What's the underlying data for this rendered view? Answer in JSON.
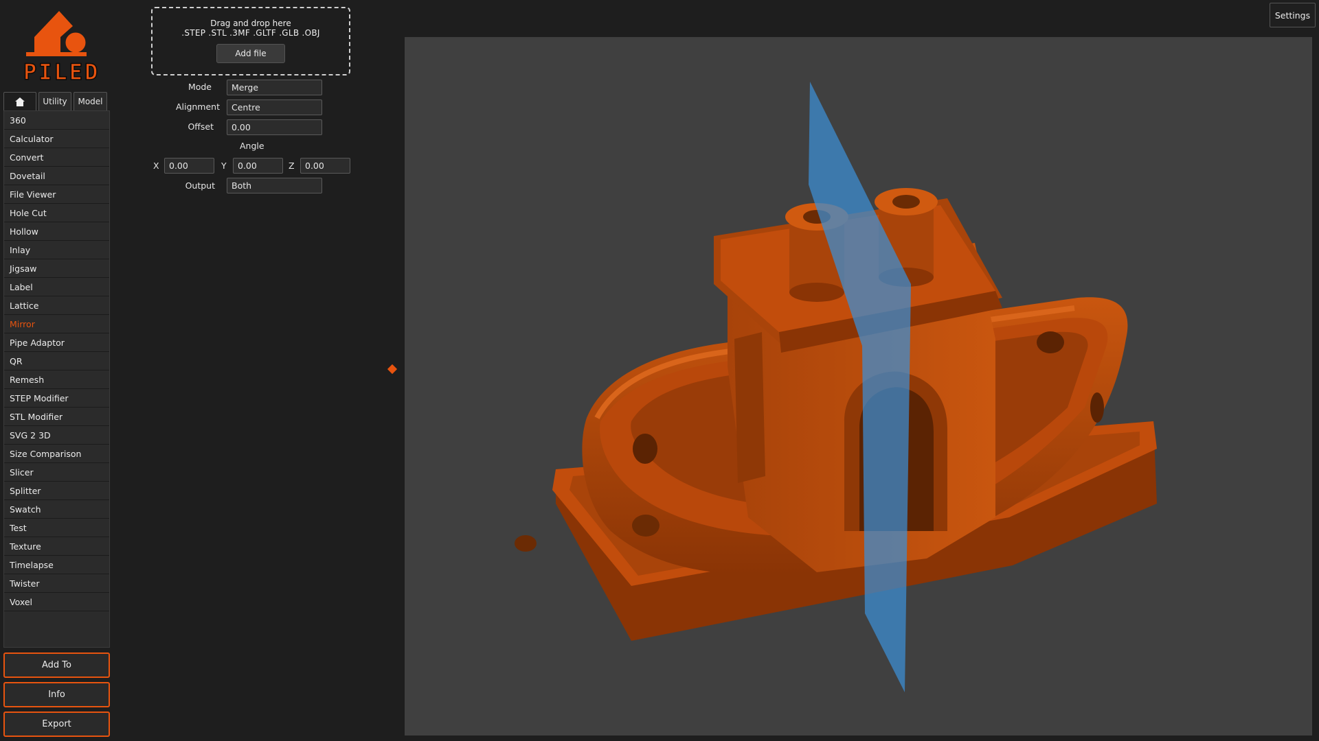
{
  "app": {
    "logo_text": "PILED",
    "accent_color": "#e8540f"
  },
  "tabs": {
    "home_icon": "home-icon",
    "utility_label": "Utility",
    "model_label": "Model"
  },
  "tools": {
    "items": [
      "360",
      "Calculator",
      "Convert",
      "Dovetail",
      "File Viewer",
      "Hole Cut",
      "Hollow",
      "Inlay",
      "Jigsaw",
      "Label",
      "Lattice",
      "Mirror",
      "Pipe Adaptor",
      "QR",
      "Remesh",
      "STEP Modifier",
      "STL Modifier",
      "SVG 2 3D",
      "Size Comparison",
      "Slicer",
      "Splitter",
      "Swatch",
      "Test",
      "Texture",
      "Timelapse",
      "Twister",
      "Voxel"
    ],
    "selected": "Mirror"
  },
  "actions": {
    "add_to": "Add To",
    "info": "Info",
    "export": "Export"
  },
  "dropzone": {
    "line1": "Drag and drop here",
    "line2": ".STEP .STL .3MF .GLTF .GLB .OBJ",
    "button": "Add file"
  },
  "form": {
    "mode_label": "Mode",
    "mode_value": "Merge",
    "alignment_label": "Alignment",
    "alignment_value": "Centre",
    "offset_label": "Offset",
    "offset_value": "0.00",
    "angle_label": "Angle",
    "x_label": "X",
    "x_value": "0.00",
    "y_label": "Y",
    "y_value": "0.00",
    "z_label": "Z",
    "z_value": "0.00",
    "output_label": "Output",
    "output_value": "Both"
  },
  "header": {
    "settings_label": "Settings"
  },
  "viewport": {
    "model_color": "#c24d0c",
    "plane_color": "#3c8fd6",
    "background": "#404040"
  }
}
